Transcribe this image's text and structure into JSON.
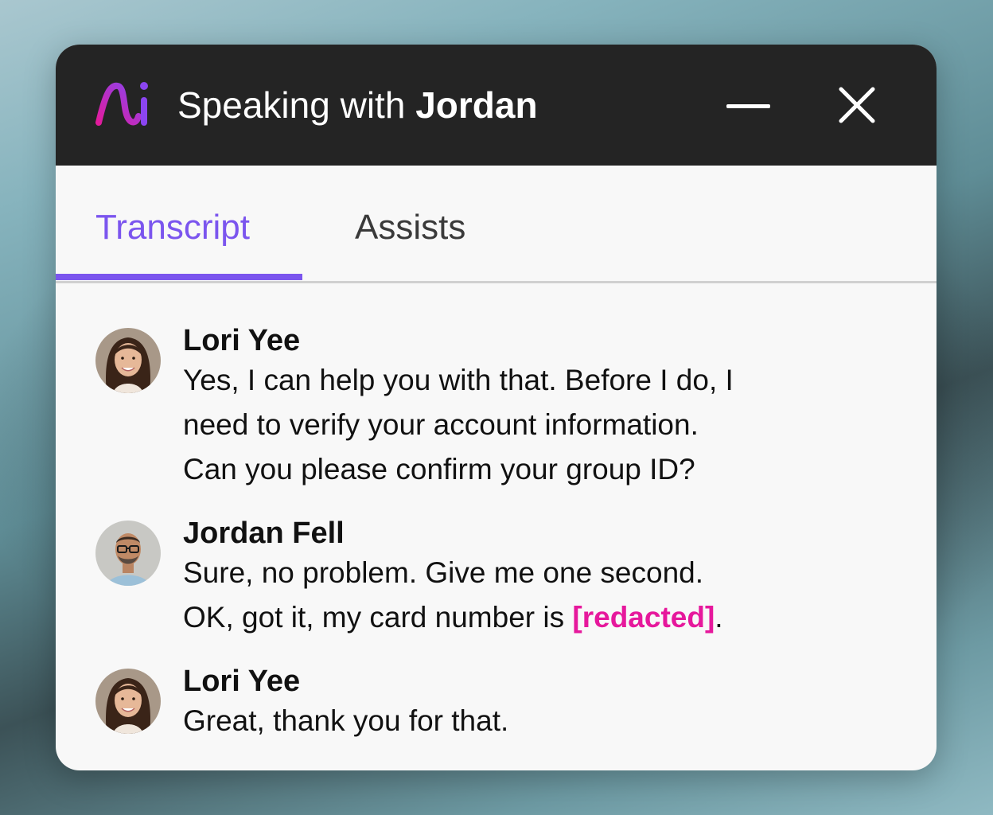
{
  "window": {
    "title_prefix": "Speaking with ",
    "title_name": "Jordan",
    "minimize_icon": "minimize-icon",
    "close_icon": "close-icon"
  },
  "tabs": [
    {
      "label": "Transcript",
      "active": true
    },
    {
      "label": "Assists",
      "active": false
    }
  ],
  "colors": {
    "accent": "#7b55ee",
    "redacted": "#e6189c",
    "titlebar": "#242424",
    "logo_gradient": [
      "#e21b9c",
      "#8b45f0"
    ]
  },
  "messages": [
    {
      "sender": "Lori Yee",
      "avatar": "woman-avatar",
      "lines": [
        "Yes, I can help you with that. Before I do, I",
        "need to verify your account information.",
        "Can you please confirm your group ID?"
      ]
    },
    {
      "sender": "Jordan Fell",
      "avatar": "man-avatar",
      "lines": [
        "Sure, no problem. Give me one second.",
        "OK, got it, my card number is "
      ],
      "redacted": "[redacted]",
      "after_redacted": "."
    },
    {
      "sender": "Lori Yee",
      "avatar": "woman-avatar",
      "lines": [
        "Great, thank you for that."
      ]
    }
  ]
}
